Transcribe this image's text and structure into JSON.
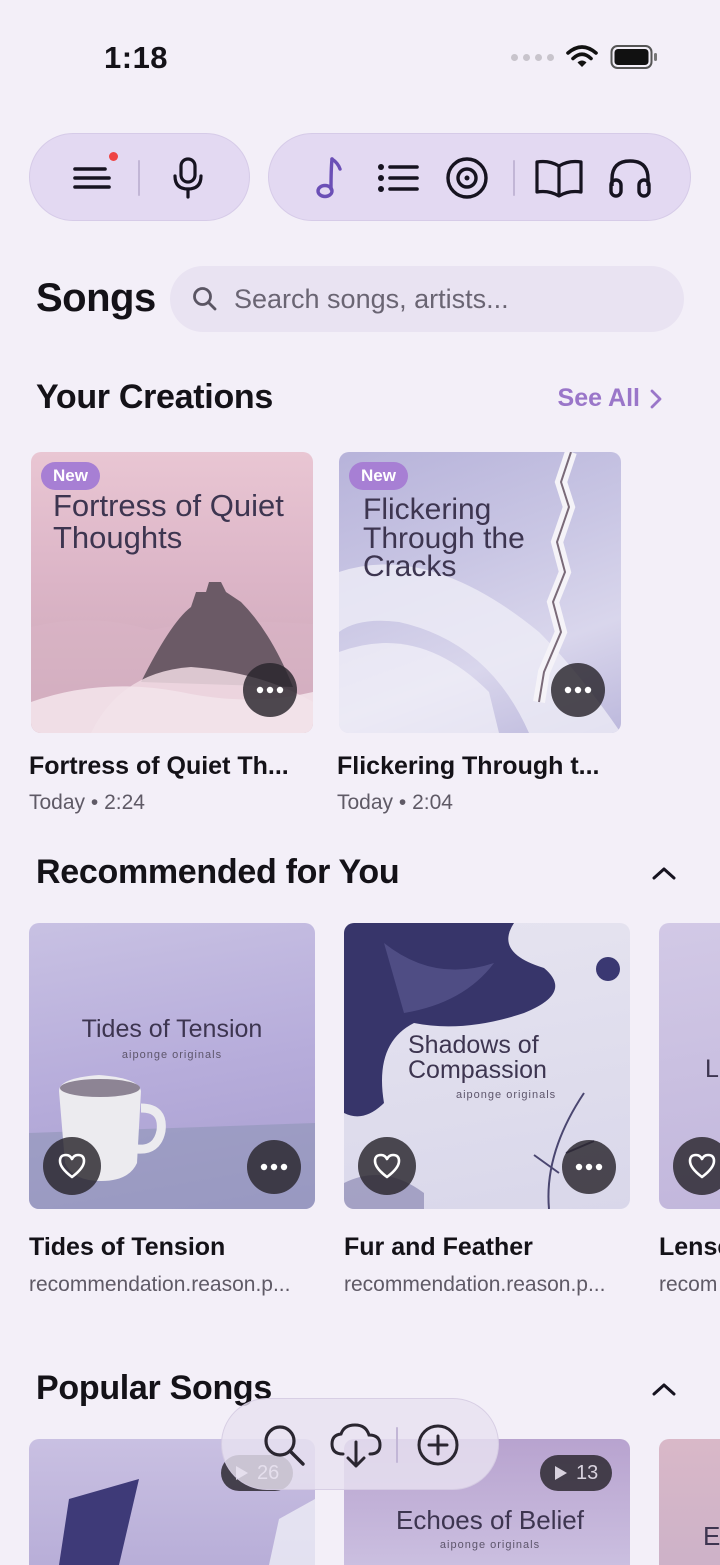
{
  "status": {
    "time": "1:18"
  },
  "nav": {
    "left": [
      "menu-icon",
      "microphone-icon"
    ],
    "right": [
      "music-note-icon",
      "list-icon",
      "disc-icon",
      "book-icon",
      "headphones-icon"
    ]
  },
  "page": {
    "title": "Songs"
  },
  "search": {
    "placeholder": "Search songs, artists..."
  },
  "creations": {
    "title": "Your Creations",
    "see_all": "See All",
    "items": [
      {
        "badge": "New",
        "art_title": "Fortress of Quiet Thoughts",
        "name": "Fortress of Quiet Th...",
        "date": "Today",
        "duration": "2:24"
      },
      {
        "badge": "New",
        "art_title": "Flickering Through the Cracks",
        "name": "Flickering Through t...",
        "date": "Today",
        "duration": "2:04"
      }
    ]
  },
  "recommended": {
    "title": "Recommended for You",
    "items": [
      {
        "art_title": "Tides of Tension",
        "art_sub": "aiponge originals",
        "name": "Tides of Tension",
        "reason": "recommendation.reason.p..."
      },
      {
        "art_title": "Shadows of Compassion",
        "art_sub": "aiponge originals",
        "name": "Fur and Feather",
        "reason": "recommendation.reason.p..."
      },
      {
        "art_title": "L",
        "name": "Lense",
        "reason": "recom"
      }
    ]
  },
  "popular": {
    "title": "Popular Songs",
    "items": [
      {
        "plays": "26"
      },
      {
        "plays": "13",
        "art_title": "Echoes of Belief",
        "art_sub": "aiponge originals"
      },
      {
        "art_title": "E"
      }
    ]
  },
  "bottom_bar": [
    "search-icon",
    "cloud-download-icon",
    "plus-circle-icon"
  ],
  "colors": {
    "accent": "#9a76c9",
    "background": "#f3eff8",
    "pill": "#e3d9f2",
    "badge": "#a77fd4"
  }
}
